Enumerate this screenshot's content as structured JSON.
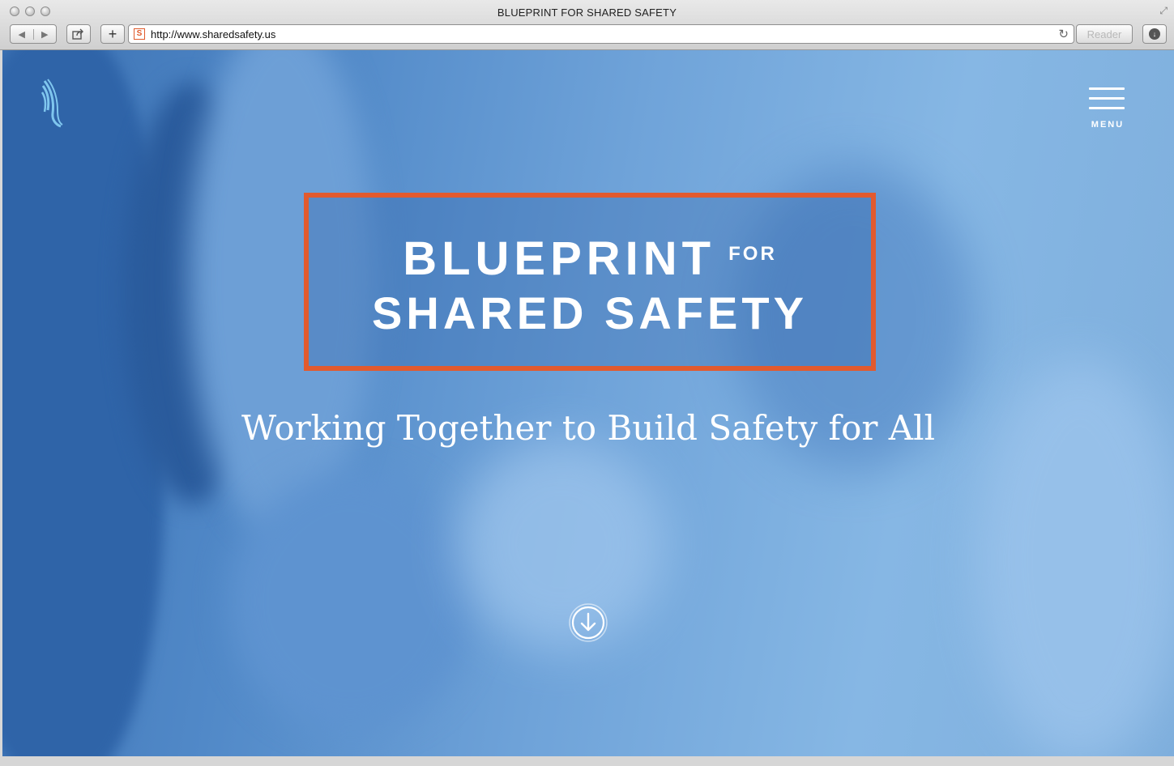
{
  "browser": {
    "window_title": "BLUEPRINT FOR SHARED SAFETY",
    "url": "http://www.sharedsafety.us",
    "favicon_letter": "S",
    "reader_label": "Reader",
    "icons": {
      "back": "back-arrow-icon",
      "forward": "forward-arrow-icon",
      "share": "share-icon",
      "new_tab": "plus-icon",
      "reload": "reload-icon",
      "download": "download-icon"
    }
  },
  "page": {
    "menu_label": "MENU",
    "title_line1_main": "BLUEPRINT",
    "title_line1_small": "FOR",
    "title_line2": "SHARED SAFETY",
    "tagline": "Working Together to Build Safety for All",
    "colors": {
      "accent_border": "#e25a2e",
      "hero_blue": "#5189c8",
      "logo_blue": "#7fc6ee",
      "text": "#ffffff"
    }
  }
}
